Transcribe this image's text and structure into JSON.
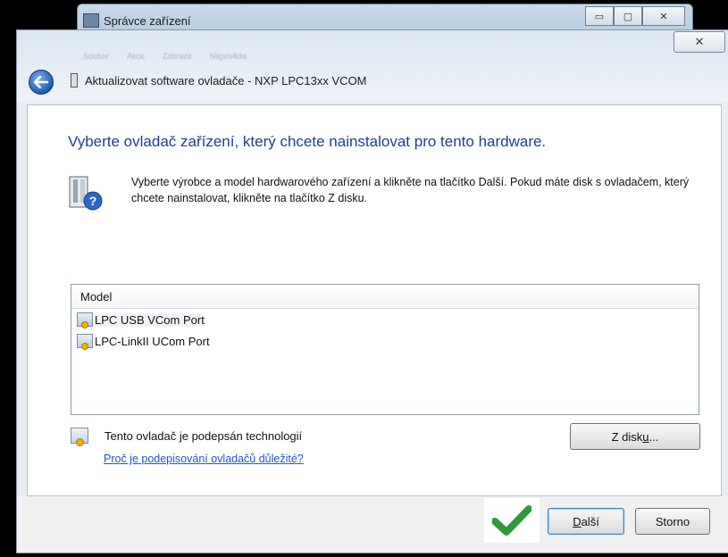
{
  "background_window": {
    "title": "Správce zařízení",
    "minimize": "▭",
    "maximize": "▢",
    "close": "✕",
    "menu": [
      "Soubor",
      "Akce",
      "Zobrazit",
      "Nápověda"
    ]
  },
  "dialog": {
    "close": "✕",
    "title": "Aktualizovat software ovladače - NXP LPC13xx VCOM",
    "heading": "Vyberte ovladač zařízení, který chcete nainstalovat pro tento hardware.",
    "description": "Vyberte výrobce a model hardwarového zařízení a klikněte na tlačítko Další. Pokud máte disk s ovladačem, který chcete nainstalovat, klikněte na tlačítko Z disku.",
    "list": {
      "header": "Model",
      "items": [
        {
          "label": "LPC USB VCom Port"
        },
        {
          "label": "LPC-LinkII UCom Port"
        }
      ]
    },
    "signed_text": "Tento ovladač je podepsán technologií",
    "why_link": "Proč je podepisování ovladačů důležité?",
    "disk_button": {
      "pre": "Z disk",
      "accel": "u",
      "post": "..."
    },
    "next_button": {
      "accel": "D",
      "rest": "alší"
    },
    "cancel_button": "Storno"
  },
  "colors": {
    "heading": "#1e3f8a",
    "link": "#1f56c9",
    "check": "#2e9a3c"
  }
}
